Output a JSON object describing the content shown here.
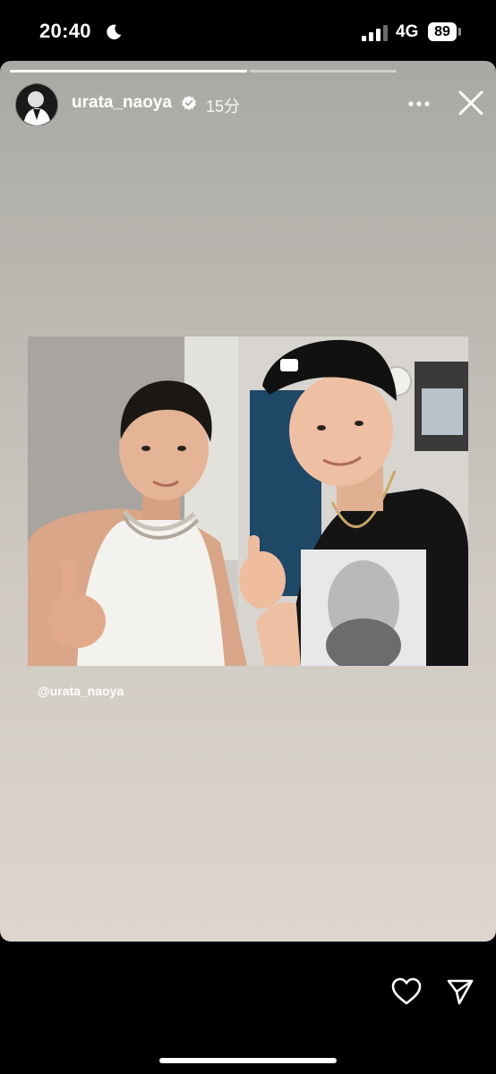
{
  "status_bar": {
    "time": "20:40",
    "network": "4G",
    "battery_level": "89",
    "icons": [
      "moon-icon",
      "signal-icon"
    ]
  },
  "story": {
    "progress": [
      1.0,
      0.0
    ],
    "username": "urata_naoya",
    "verified": true,
    "timestamp": "15分",
    "mention": "@urata_naoya",
    "icons": [
      "verified-icon",
      "more-icon",
      "close-icon"
    ]
  },
  "bottom_bar": {
    "icons": [
      "heart-icon",
      "send-icon"
    ]
  },
  "colors": {
    "background": "#000000",
    "story_gradient_top": "#a9a9a4",
    "story_gradient_bottom": "#dcd6ce",
    "text": "#ffffff",
    "shirt": "#141414"
  }
}
